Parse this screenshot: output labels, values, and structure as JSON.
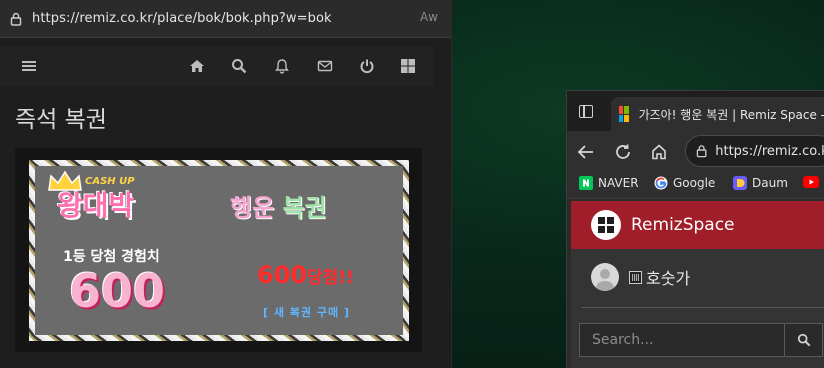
{
  "left_window": {
    "address_bar": {
      "url": "https://remiz.co.kr/place/bok/bok.php?w=bok",
      "read_aloud": "Aᴡ"
    },
    "nav_icons": [
      "menu-icon",
      "home-icon",
      "search-icon",
      "bell-icon",
      "mail-icon",
      "power-icon",
      "grid-icon"
    ],
    "page_title": "즉석 복권",
    "ticket": {
      "brand_small": "CASH UP",
      "brand_big": "왕대박",
      "title_part1": "행운",
      "title_part2": "복권",
      "first_prize_label": "1등 당첨 경험치",
      "first_prize_value": "600",
      "won_value": "600",
      "won_text": "당첨!!",
      "buy_new": "[ 새 복권 구매 ]"
    }
  },
  "right_window": {
    "tab_title": "가즈아! 행운 복권 | Remiz Space -",
    "url": "https://remiz.co.kr",
    "bookmarks": [
      "NAVER",
      "Google",
      "Daum",
      ""
    ],
    "site_name": "RemizSpace",
    "user_name": "호숫가",
    "search_placeholder": "Search..."
  },
  "colors": {
    "site_header": "#a01e2a",
    "ticket_bg": "#6b6b6b",
    "prize_red": "#ff2a2a",
    "buy_blue": "#5fb6ff"
  }
}
